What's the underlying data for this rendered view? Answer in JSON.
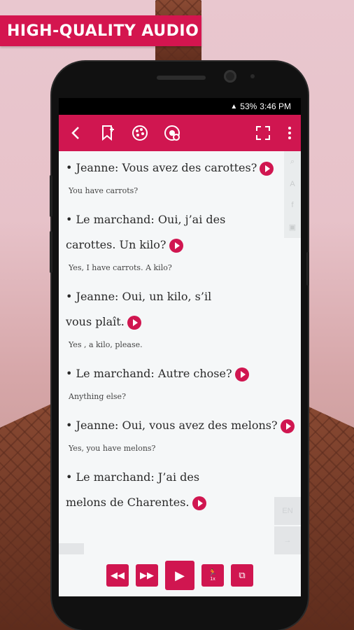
{
  "banner": {
    "text": "HIGH-QUALITY AUDIO"
  },
  "status": {
    "battery": "53%",
    "time": "3:46 PM"
  },
  "toolbar": {
    "back_icon": "chevron-left-icon",
    "bookmark_icon": "bookmark-icon",
    "settings_icon": "palette-icon",
    "audio_icon": "audio-settings-icon",
    "fullscreen_icon": "fullscreen-icon",
    "menu_icon": "more-vertical-icon"
  },
  "dialogue": [
    {
      "fr": "Jeanne: Vous avez des carottes?",
      "en": "You have carrots?"
    },
    {
      "fr": "Le marchand: Oui, j’ai des carottes. Un kilo?",
      "en": "Yes, I have carrots. A kilo?"
    },
    {
      "fr": "Jeanne: Oui, un kilo, s’il vous plaît.",
      "en": "Yes , a kilo, please."
    },
    {
      "fr": "Le marchand: Autre chose?",
      "en": "Anything else?"
    },
    {
      "fr": "Jeanne: Oui, vous avez des melons?",
      "en": "Yes, you have melons?"
    },
    {
      "fr": "Le marchand: J’ai des melons de Charentes.",
      "en": ""
    }
  ],
  "side_panel": {
    "lang": "EN"
  },
  "controls": {
    "speed": "1x"
  },
  "colors": {
    "accent": "#d01650",
    "banner": "#d4154f"
  }
}
